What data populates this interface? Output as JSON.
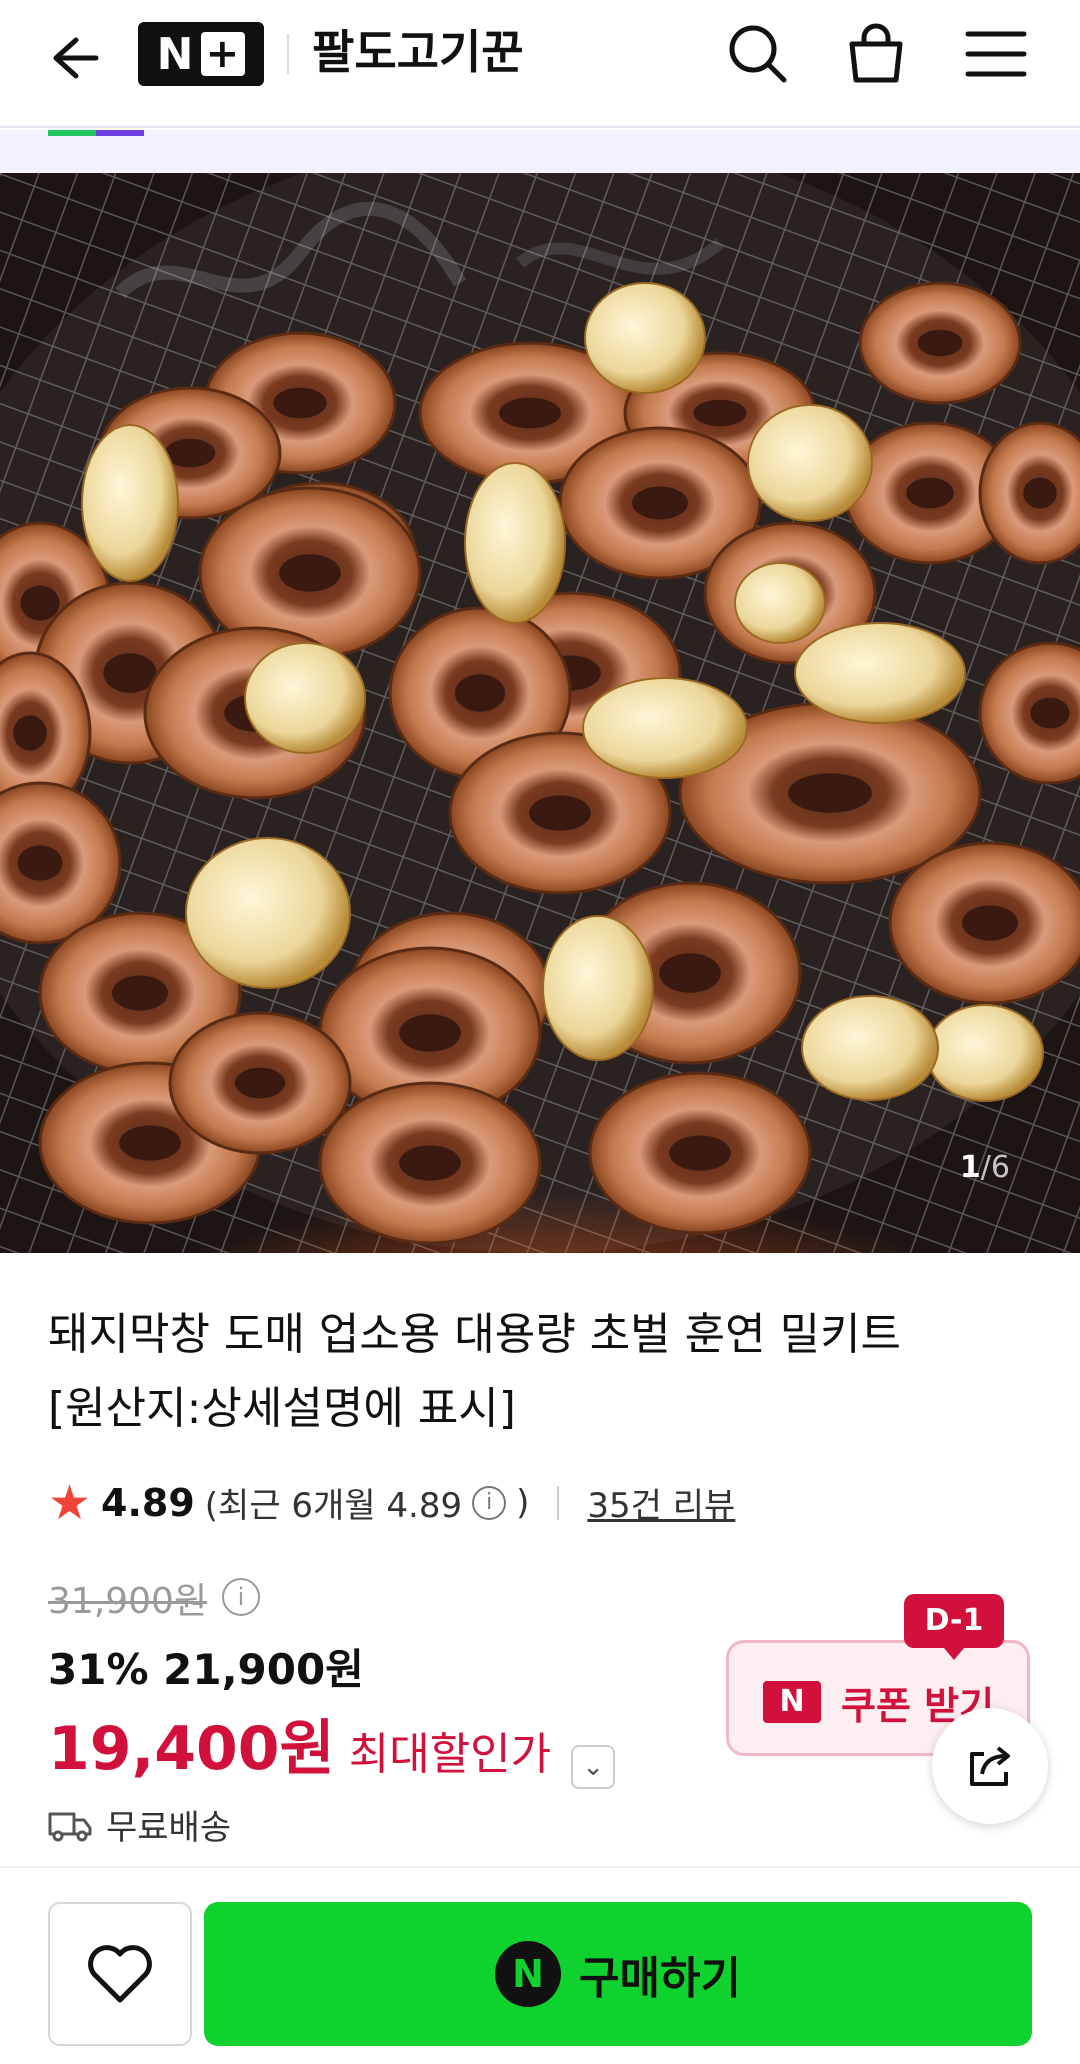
{
  "header": {
    "back_icon": "arrow-left-icon",
    "brand_text": "N",
    "brand_plus": "+",
    "store_name": "팔도고기꾼",
    "icons": [
      "search-icon",
      "shopping-bag-icon",
      "menu-icon"
    ]
  },
  "gallery": {
    "current": "1",
    "total": "/6"
  },
  "product": {
    "title_line1": "돼지막창 도매 업소용 대용량 초벌 훈연 밀키트",
    "title_line2": "[원산지:상세설명에 표시]",
    "rating": {
      "star": "★",
      "score": "4.89",
      "recent_prefix": "(최근 6개월 4.89",
      "recent_suffix": ")",
      "info_glyph": "i",
      "reviews": "35건 리뷰"
    },
    "price": {
      "original": "31,900원",
      "info_glyph": "i",
      "sale": "31% 21,900원",
      "max_price": "19,400원",
      "max_label": "최대할인가",
      "chevron": "⌄"
    },
    "coupon": {
      "badge": "D-1",
      "logo": "N",
      "label": "쿠폰 받기"
    },
    "delivery": "무료배송"
  },
  "bottom_bar": {
    "wish_icon": "heart-icon",
    "buy_logo": "N",
    "buy_label": "구매하기"
  },
  "colors": {
    "accent_red": "#d1113b",
    "buy_green": "#0fd22f",
    "star": "#f04438"
  }
}
